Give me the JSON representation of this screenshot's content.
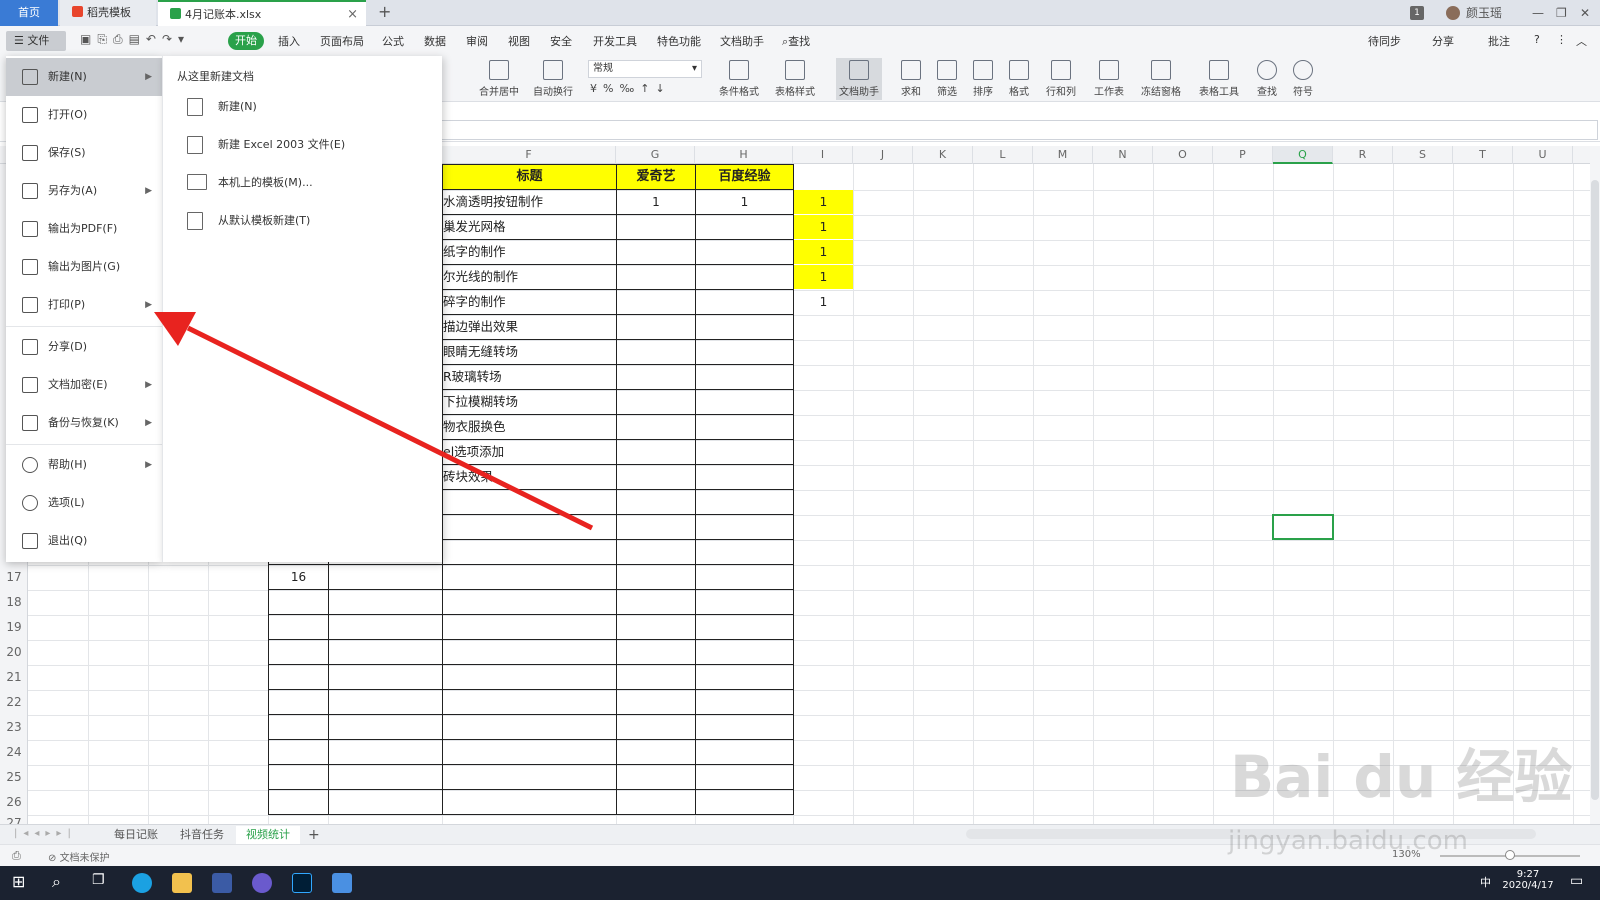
{
  "titlebar": {
    "tabs": [
      {
        "label": "首页"
      },
      {
        "label": "稻壳模板"
      },
      {
        "label": "4月记账本.xlsx"
      }
    ],
    "new_tab": "+",
    "close_tab": "×",
    "badge": "1",
    "user": "颜玉瑶",
    "minimize": "—",
    "restore": "❐",
    "close": "✕"
  },
  "menubar": {
    "file": "文件",
    "start": "开始",
    "items": [
      "插入",
      "页面布局",
      "公式",
      "数据",
      "审阅",
      "视图",
      "安全",
      "开发工具",
      "特色功能",
      "文档助手"
    ],
    "search": "查找",
    "right": [
      "待同步",
      "分享",
      "批注"
    ]
  },
  "ribbon": {
    "merge": "合并居中",
    "wrap": "自动换行",
    "format_value": "常规",
    "cond_format": "条件格式",
    "table_style": "表格样式",
    "doc_assist": "文档助手",
    "sum": "求和",
    "filter": "筛选",
    "sort": "排序",
    "format": "格式",
    "rowcol": "行和列",
    "worksheet": "工作表",
    "freeze": "冻结窗格",
    "table_tool": "表格工具",
    "find": "查找",
    "symbol": "符号"
  },
  "columns": [
    "F",
    "G",
    "H",
    "I",
    "J",
    "K",
    "L",
    "M",
    "N",
    "O",
    "P",
    "Q",
    "R",
    "S",
    "T",
    "U"
  ],
  "rows": [
    "17",
    "18",
    "19",
    "20",
    "21",
    "22",
    "23",
    "24",
    "25",
    "26",
    "27"
  ],
  "table": {
    "headers": [
      "标题",
      "爱奇艺",
      "百度经验"
    ],
    "titles": [
      "水滴透明按钮制作",
      "巢发光网格",
      "纸字的制作",
      "尔光线的制作",
      "碎字的制作",
      "描边弹出效果",
      "眼睛无缝转场",
      "R玻璃转场",
      "下拉模糊转场",
      "物衣服换色",
      "el选项添加",
      "砖块效果"
    ],
    "g1": "1",
    "h1": "1",
    "i_values": [
      "1",
      "1",
      "1",
      "1",
      "1"
    ],
    "row17_num": "16"
  },
  "file_menu": {
    "items": [
      {
        "label": "新建(N)",
        "icon": "new-file-icon"
      },
      {
        "label": "打开(O)",
        "icon": "folder-icon"
      },
      {
        "label": "保存(S)",
        "icon": "save-icon"
      },
      {
        "label": "另存为(A)",
        "icon": "save-as-icon"
      },
      {
        "label": "输出为PDF(F)",
        "icon": "pdf-icon"
      },
      {
        "label": "输出为图片(G)",
        "icon": "image-icon"
      },
      {
        "label": "打印(P)",
        "icon": "print-icon"
      },
      {
        "label": "分享(D)",
        "icon": "share-icon"
      },
      {
        "label": "文档加密(E)",
        "icon": "lock-icon"
      },
      {
        "label": "备份与恢复(K)",
        "icon": "backup-icon"
      },
      {
        "label": "帮助(H)",
        "icon": "help-icon"
      },
      {
        "label": "选项(L)",
        "icon": "gear-icon"
      },
      {
        "label": "退出(Q)",
        "icon": "exit-icon"
      }
    ]
  },
  "sub_panel": {
    "title": "从这里新建文档",
    "items": [
      "新建(N)",
      "新建 Excel 2003 文件(E)",
      "本机上的模板(M)...",
      "从默认模板新建(T)"
    ]
  },
  "sheets": [
    "每日记账",
    "抖音任务",
    "视频统计"
  ],
  "add_sheet": "+",
  "status": {
    "protect": "文档未保护",
    "zoom": "130%"
  },
  "taskbar": {
    "time": "9:27",
    "date": "2020/4/17",
    "ime": "中"
  },
  "watermark": {
    "line1": "Bai du 经验",
    "line2": "jingyan.baidu.com"
  },
  "colors": {
    "accent": "#2aa14a",
    "home_tab": "#3a7bd5",
    "highlight": "#ffff00",
    "arrow": "#e8231f"
  }
}
